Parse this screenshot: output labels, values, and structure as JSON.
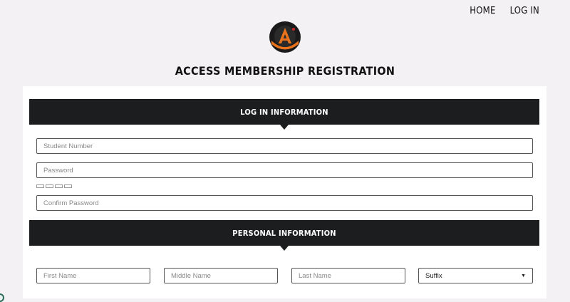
{
  "nav": {
    "home": "HOME",
    "login": "LOG IN"
  },
  "logo": {
    "letter": "A",
    "colors": {
      "dark": "#1a1a1a",
      "accent": "#e8731c"
    }
  },
  "page": {
    "title": "ACCESS MEMBERSHIP REGISTRATION"
  },
  "sections": {
    "login_info": "LOG IN INFORMATION",
    "personal_info": "PERSONAL INFORMATION"
  },
  "fields": {
    "student_number": {
      "placeholder": "Student Number",
      "value": ""
    },
    "password": {
      "placeholder": "Password",
      "value": ""
    },
    "confirm_password": {
      "placeholder": "Confirm Password",
      "value": ""
    },
    "first_name": {
      "placeholder": "First Name",
      "value": ""
    },
    "middle_name": {
      "placeholder": "Middle Name",
      "value": ""
    },
    "last_name": {
      "placeholder": "Last Name",
      "value": ""
    },
    "suffix": {
      "selected": "Suffix"
    }
  },
  "theme": {
    "bar": "#1b1d1f",
    "background": "#f3f1f4"
  }
}
